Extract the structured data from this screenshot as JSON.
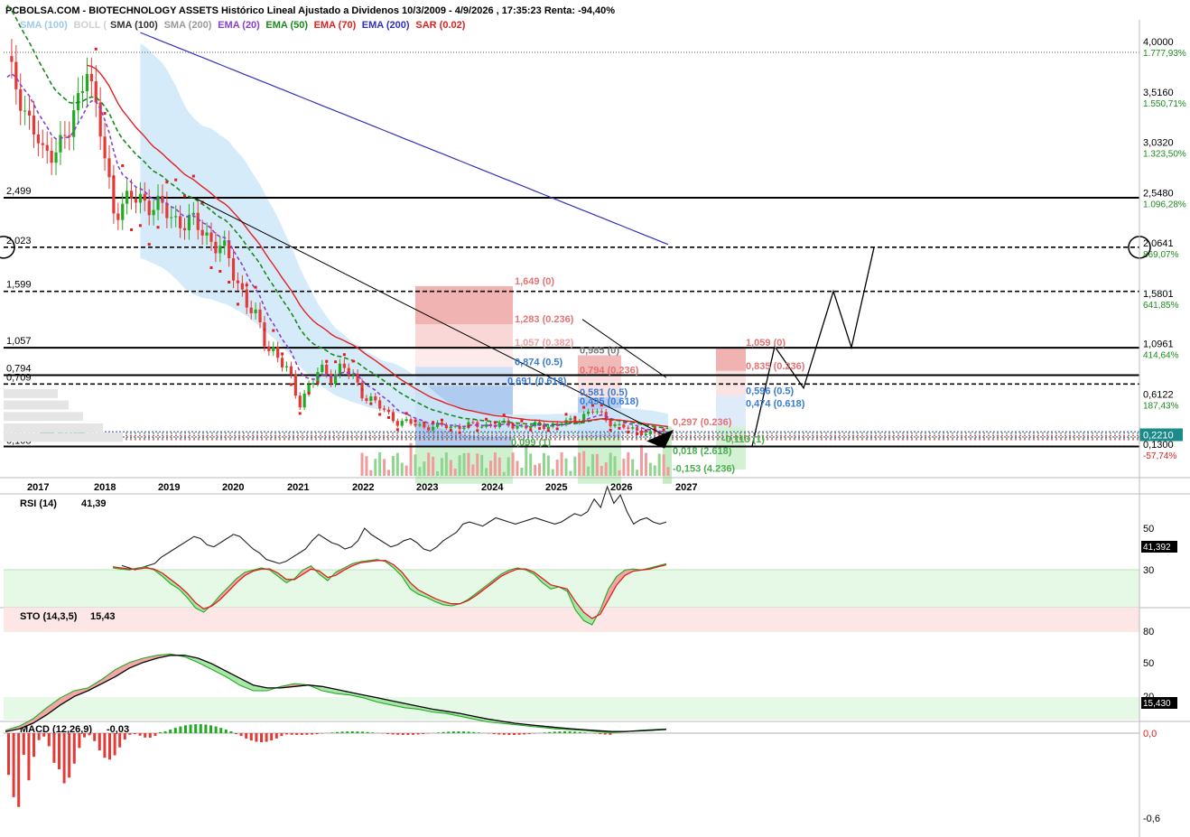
{
  "header": {
    "title": "PCBOLSA.COM - BIOTECHNOLOGY ASSETS Histórico Lineal Ajustado a Dividenos 10/3/2009 - 4/9/2026 , 17:35:23 Renta: -94,40%"
  },
  "legend": [
    {
      "label": "SMA (100)",
      "color": "#9ecae8"
    },
    {
      "label": "BOLL (",
      "color": "#cfcfcf"
    },
    {
      "label": "SMA (100)",
      "color": "#333333"
    },
    {
      "label": "SMA (200)",
      "color": "#999999"
    },
    {
      "label": "EMA (20)",
      "color": "#8a3fd1"
    },
    {
      "label": "EMA (50)",
      "color": "#1a8a1a"
    },
    {
      "label": "EMA (70)",
      "color": "#e02020"
    },
    {
      "label": "EMA (200)",
      "color": "#3030c0"
    },
    {
      "label": "SAR (0.02)",
      "color": "#e02020"
    }
  ],
  "colors": {
    "up": "#22aa22",
    "down": "#e53935",
    "ema20": "#8a3fd1",
    "ema50": "#1a8a1a",
    "ema70": "#e02020",
    "ema200": "#3030c0",
    "boll": "#cfe8f8",
    "sar": "#e02020",
    "rsiZone": "#e6f8e6",
    "stoHigh": "#fde6e6"
  },
  "chart_data": [
    {
      "type": "candlestick",
      "title": "BIOTECHNOLOGY ASSETS",
      "x_ticks": [
        "2017",
        "2018",
        "2019",
        "2020",
        "2021",
        "2022",
        "2023",
        "2024",
        "2025",
        "2026",
        "2027"
      ],
      "y_ticks": [
        {
          "value": "4,0000",
          "pct": "1.777,93%"
        },
        {
          "value": "3,5160",
          "pct": "1.550,71%"
        },
        {
          "value": "3,0320",
          "pct": "1.323,50%"
        },
        {
          "value": "2,5480",
          "pct": "1.096,28%"
        },
        {
          "value": "2,0641",
          "pct": "869,07%"
        },
        {
          "value": "1,5801",
          "pct": "641,85%"
        },
        {
          "value": "1,0961",
          "pct": "414,64%"
        },
        {
          "value": "0,6122",
          "pct": "187,43%"
        },
        {
          "value": "0,1300",
          "pct": "-57,74%"
        }
      ],
      "last_price": "0,2210",
      "ylim": [
        0.0,
        4.2
      ],
      "horizontal_levels": [
        {
          "label": "2,499",
          "value": 2.499,
          "style": "solid"
        },
        {
          "label": "2,023",
          "value": 2.023,
          "style": "dashed"
        },
        {
          "label": "1,599",
          "value": 1.599,
          "style": "dashed"
        },
        {
          "label": "1,057",
          "value": 1.057,
          "style": "solid"
        },
        {
          "label": "0,794",
          "value": 0.794,
          "style": "solid"
        },
        {
          "label": "0,709",
          "value": 0.709,
          "style": "dashed"
        },
        {
          "label": "0,3780",
          "value": 0.25,
          "style": "dotted"
        },
        {
          "label": "0,1770",
          "value": 0.2,
          "style": "dotted"
        },
        {
          "label": "0,108",
          "value": 0.108,
          "style": "solid"
        }
      ],
      "left_labels": [
        "0,3780",
        "0,1770",
        "0,108",
        "-5,33%"
      ],
      "fib_labels": [
        {
          "text": "1,649 (0)",
          "color": "#e57373"
        },
        {
          "text": "1,283 (0.236)",
          "color": "#e57373"
        },
        {
          "text": "1,057 (0.382)",
          "color": "#f3a0a0"
        },
        {
          "text": "0,874 (0.5)",
          "color": "#3a7bd5"
        },
        {
          "text": "0,691 (0.618)",
          "color": "#3a7bd5"
        },
        {
          "text": "0,099 (1)",
          "color": "#4caf50"
        },
        {
          "text": "0,985 (0)",
          "color": "#777777"
        },
        {
          "text": "0,794 (0.236)",
          "color": "#e57373"
        },
        {
          "text": "0,581 (0.5)",
          "color": "#3a7bd5"
        },
        {
          "text": "0,495 (0.618)",
          "color": "#3a7bd5"
        },
        {
          "text": "0,297 (0.236)",
          "color": "#e57373"
        },
        {
          "text": "0,018 (2.618)",
          "color": "#4caf50"
        },
        {
          "text": "-0,153 (4.236)",
          "color": "#4caf50"
        },
        {
          "text": "1,059 (0)",
          "color": "#e57373"
        },
        {
          "text": "0,835 (0.236)",
          "color": "#e57373"
        },
        {
          "text": "0,596 (0.5)",
          "color": "#3a7bd5"
        },
        {
          "text": "0,474 (0.618)",
          "color": "#3a7bd5"
        },
        {
          "text": "-0,113 (1)",
          "color": "#4caf50"
        }
      ]
    },
    {
      "type": "line",
      "title": "RSI (14)",
      "current": "41,39",
      "last_value": "41,392",
      "y_ticks": [
        "50",
        "30"
      ],
      "values": [
        32,
        31,
        30,
        31,
        32,
        33,
        36,
        38,
        40,
        42,
        44,
        46,
        45,
        42,
        41,
        43,
        45,
        47,
        46,
        43,
        40,
        38,
        35,
        34,
        33,
        34,
        36,
        38,
        40,
        44,
        47,
        45,
        43,
        42,
        40,
        41,
        44,
        50,
        47,
        45,
        43,
        41,
        42,
        44,
        45,
        43,
        40,
        39,
        41,
        44,
        46,
        48,
        52,
        53,
        52,
        51,
        53,
        55,
        54,
        53,
        52,
        53,
        54,
        55,
        54,
        53,
        52,
        53,
        55,
        57,
        56,
        58,
        64,
        60,
        70,
        62,
        66,
        58,
        52,
        54,
        55,
        53,
        52,
        53
      ]
    },
    {
      "type": "line",
      "title": "STO (14,3,5)",
      "current": "15,43",
      "last_value": "15,430",
      "y_ticks": [
        "80",
        "50",
        "20"
      ],
      "series": [
        {
          "name": "%K",
          "values": [
            20,
            21,
            22,
            20,
            19,
            22,
            28,
            35,
            40,
            48,
            58,
            62,
            55,
            46,
            38,
            30,
            24,
            22,
            20,
            22,
            28,
            34,
            30,
            22,
            18,
            26,
            32,
            24,
            20,
            16,
            14,
            13,
            12,
            14,
            20,
            28,
            40,
            45,
            48,
            52,
            55,
            56,
            54,
            50,
            44,
            38,
            32,
            26,
            22,
            20,
            22,
            26,
            34,
            40,
            38,
            42,
            60,
            70,
            74,
            60,
            40,
            28,
            22,
            21,
            22,
            20,
            18,
            16
          ]
        },
        {
          "name": "%D",
          "values": [
            19,
            20,
            21,
            21,
            20,
            21,
            25,
            31,
            37,
            44,
            53,
            59,
            56,
            50,
            42,
            34,
            27,
            23,
            21,
            21,
            25,
            31,
            31,
            26,
            21,
            23,
            29,
            27,
            22,
            18,
            15,
            14,
            13,
            13,
            17,
            24,
            34,
            41,
            45,
            49,
            52,
            54,
            54,
            51,
            46,
            40,
            34,
            28,
            24,
            21,
            21,
            24,
            30,
            36,
            38,
            40,
            52,
            62,
            68,
            64,
            50,
            36,
            27,
            23,
            22,
            21,
            19,
            17
          ]
        }
      ]
    },
    {
      "type": "line",
      "title": "MACD (12,26,9)",
      "current": "-0,03",
      "y_ticks": [
        "0,0",
        "-0,6"
      ],
      "series": [
        {
          "name": "MACD",
          "values": [
            -0.02,
            -0.05,
            -0.1,
            -0.18,
            -0.25,
            -0.3,
            -0.32,
            -0.38,
            -0.45,
            -0.5,
            -0.53,
            -0.55,
            -0.56,
            -0.54,
            -0.5,
            -0.45,
            -0.4,
            -0.34,
            -0.3,
            -0.3,
            -0.33,
            -0.35,
            -0.34,
            -0.3,
            -0.28,
            -0.27,
            -0.25,
            -0.22,
            -0.2,
            -0.18,
            -0.17,
            -0.15,
            -0.14,
            -0.12,
            -0.1,
            -0.08,
            -0.07,
            -0.06,
            -0.05,
            -0.04,
            -0.03,
            -0.025,
            -0.02,
            -0.01,
            -0.005,
            -0.01,
            -0.02,
            -0.025,
            -0.03
          ]
        },
        {
          "name": "Signal",
          "values": [
            -0.01,
            -0.03,
            -0.07,
            -0.13,
            -0.2,
            -0.26,
            -0.3,
            -0.35,
            -0.4,
            -0.46,
            -0.5,
            -0.53,
            -0.55,
            -0.55,
            -0.53,
            -0.49,
            -0.44,
            -0.39,
            -0.34,
            -0.32,
            -0.32,
            -0.33,
            -0.34,
            -0.33,
            -0.31,
            -0.29,
            -0.27,
            -0.25,
            -0.23,
            -0.21,
            -0.19,
            -0.17,
            -0.155,
            -0.14,
            -0.12,
            -0.1,
            -0.085,
            -0.07,
            -0.06,
            -0.05,
            -0.04,
            -0.032,
            -0.025,
            -0.018,
            -0.012,
            -0.012,
            -0.016,
            -0.021,
            -0.026
          ]
        }
      ]
    }
  ]
}
